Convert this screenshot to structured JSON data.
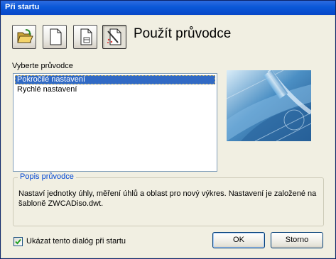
{
  "window": {
    "title": "Při startu"
  },
  "toolbar": {
    "buttons": [
      {
        "icon": "open-folder-icon",
        "active": false
      },
      {
        "icon": "blank-document-icon",
        "active": false
      },
      {
        "icon": "template-document-icon",
        "active": false
      },
      {
        "icon": "wizard-icon",
        "active": true
      }
    ]
  },
  "wizard": {
    "title": "Použít průvodce",
    "select_label": "Vyberte průvodce",
    "options": [
      {
        "label": "Pokročilé nastavení",
        "selected": true
      },
      {
        "label": "Rychlé nastavení",
        "selected": false
      }
    ],
    "preview_icon": "blueprint-preview-image"
  },
  "description": {
    "group_label": "Popis průvodce",
    "text": "Nastaví jednotky úhly, měření úhlů a oblast pro nový výkres. Nastavení je založené na šabloně ZWCADiso.dwt."
  },
  "footer": {
    "show_on_startup_label": "Ukázat tento dialóg při startu",
    "show_on_startup_checked": true,
    "ok_label": "OK",
    "cancel_label": "Storno"
  },
  "colors": {
    "titlebar": "#0a58d8",
    "selection": "#316ac5",
    "group_label": "#0046d5"
  }
}
